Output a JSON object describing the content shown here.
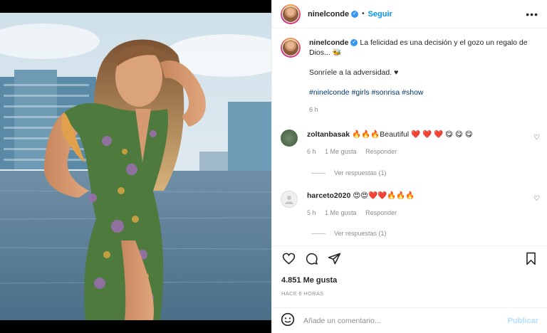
{
  "post": {
    "username": "ninelconde",
    "follow_label": "Seguir",
    "more_icon": "more-options-icon",
    "caption_line1": "La felicidad es una decisión y el gozo un regalo de Dios... 🐝",
    "caption_line2": "Sonríele a la adversidad. ♥",
    "hashtags": "#ninelconde #girls #sonrisa #show",
    "time": "6 h"
  },
  "comments": [
    {
      "username": "zoltanbasak",
      "text": "🔥🔥🔥Beautiful ❤️ ❤️ ❤️ 😋 😋 😋",
      "time": "6 h",
      "likes": "1 Me gusta",
      "reply": "Responder",
      "view_replies": "Ver respuestas (1)"
    },
    {
      "username": "harceto2020",
      "text": "😍😍❤️❤️🔥🔥🔥",
      "time": "5 h",
      "likes": "1 Me gusta",
      "reply": "Responder",
      "view_replies": "Ver respuestas (1)"
    }
  ],
  "actions": {
    "like_icon": "heart-icon",
    "comment_icon": "comment-icon",
    "share_icon": "share-icon",
    "save_icon": "bookmark-icon"
  },
  "likes_count": "4.851 Me gusta",
  "posted_ago": "HACE 6 HORAS",
  "add_comment": {
    "placeholder": "Añade un comentario...",
    "emoji_icon": "emoji-icon",
    "publish_label": "Publicar"
  },
  "colors": {
    "accent": "#0095f6",
    "publish_disabled": "#b2dffc",
    "hashtag": "#00376b",
    "muted": "#8e8e8e"
  }
}
